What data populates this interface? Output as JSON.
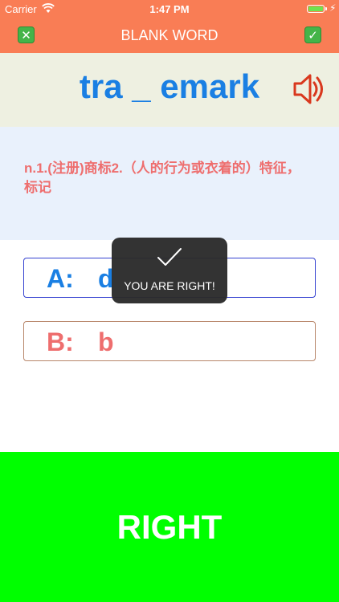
{
  "status_bar": {
    "carrier": "Carrier",
    "time": "1:47 PM",
    "battery_level": 1.0,
    "battery_color": "#6fe34f"
  },
  "nav": {
    "title": "BLANK WORD",
    "close_icon": "close-icon",
    "check_icon": "check-icon",
    "background_color": "#f97d55"
  },
  "word": {
    "text": "tra _ emark",
    "speaker_icon": "speaker-icon",
    "color": "#1a7fe3"
  },
  "definition": {
    "text": "n.1.(注册)商标2.（人的行为或衣着的）特征，标记",
    "color": "#ee6e6e"
  },
  "options": [
    {
      "letter": "A:",
      "answer": "d"
    },
    {
      "letter": "B:",
      "answer": "b"
    }
  ],
  "toast": {
    "icon": "checkmark-icon",
    "text": "YOU ARE RIGHT!"
  },
  "result": {
    "text": "RIGHT",
    "background_color": "#00ff00"
  }
}
